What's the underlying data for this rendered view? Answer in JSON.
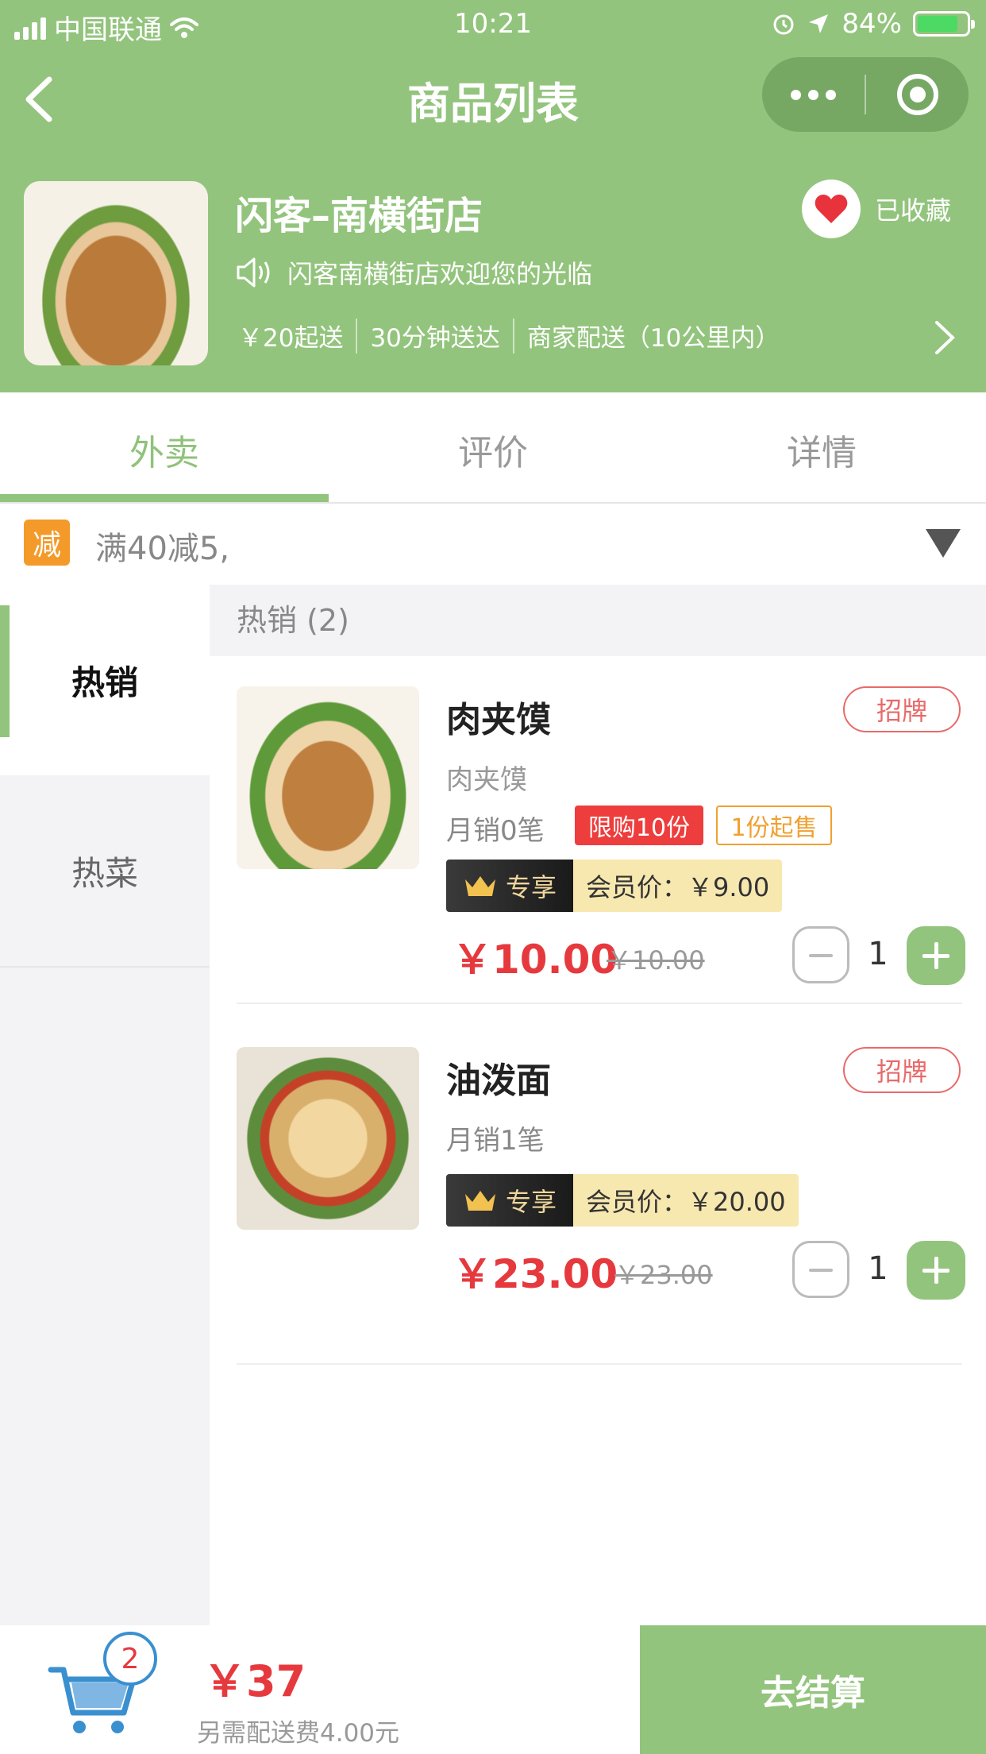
{
  "status_bar": {
    "carrier": "中国联通",
    "time": "10:21",
    "battery_percent": "84%",
    "battery_level": 0.84
  },
  "nav": {
    "title": "商品列表"
  },
  "shop": {
    "name": "闪客–南横街店",
    "favorite_label": "已收藏",
    "notice": "闪客南横街店欢迎您的光临",
    "min_order": "￥20起送",
    "delivery_time": "30分钟送达",
    "delivery_method": "商家配送（10公里内）"
  },
  "tabs": [
    {
      "label": "外卖",
      "active": true
    },
    {
      "label": "评价",
      "active": false
    },
    {
      "label": "详情",
      "active": false
    }
  ],
  "promo": {
    "badge": "减",
    "text": "满40减5,"
  },
  "categories": [
    {
      "label": "热销",
      "active": true
    },
    {
      "label": "热菜",
      "active": false
    }
  ],
  "section": {
    "title": "热销 (2)"
  },
  "products": [
    {
      "name": "肉夹馍",
      "badge": "招牌",
      "description": "肉夹馍",
      "monthly_sales": "月销0笔",
      "limit_tag": "限购10份",
      "min_tag": "1份起售",
      "member_tag": "专享",
      "member_price": "会员价：￥9.00",
      "price": "￥10.00",
      "old_price": "￥10.00",
      "quantity": "1"
    },
    {
      "name": "油泼面",
      "badge": "招牌",
      "monthly_sales": "月销1笔",
      "member_tag": "专享",
      "member_price": "会员价：￥20.00",
      "price": "￥23.00",
      "old_price": "￥23.00",
      "quantity": "1"
    }
  ],
  "cart": {
    "count": "2",
    "total": "￥37",
    "delivery_fee": "另需配送费4.00元",
    "checkout_label": "去结算"
  },
  "colors": {
    "brand_green": "#93c47d",
    "price_red": "#e6393e",
    "promo_orange": "#f39a2a"
  }
}
